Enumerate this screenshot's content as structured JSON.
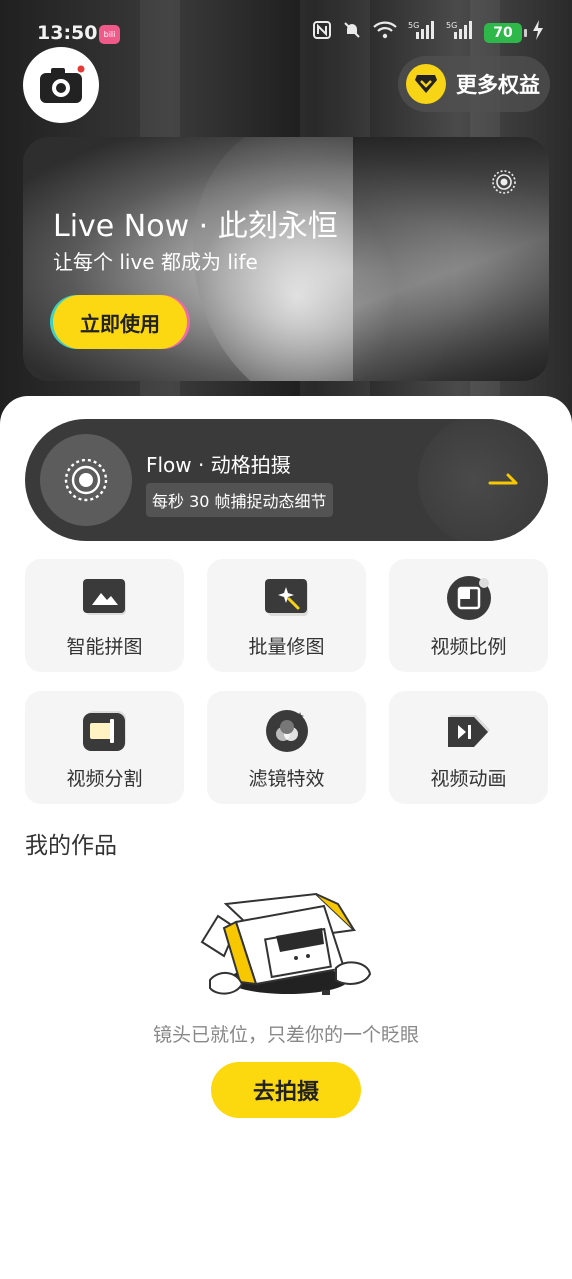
{
  "status_bar": {
    "time": "13:50",
    "app_icon": "bilibili",
    "icons": [
      "nfc-icon",
      "mute-icon",
      "wifi-icon",
      "signal-5g-icon",
      "signal-5g-icon"
    ],
    "signal_label": "5G",
    "battery": "70"
  },
  "header": {
    "camera_icon": "camera-icon",
    "benefits_label": "更多权益"
  },
  "banner": {
    "title": "Live Now · 此刻永恒",
    "subtitle": "让每个 live 都成为 life",
    "button_label": "立即使用"
  },
  "flow": {
    "title": "Flow · 动格拍摄",
    "tag": "每秒 30 帧捕捉动态细节"
  },
  "tools": [
    {
      "label": "智能拼图",
      "icon": "collage-icon"
    },
    {
      "label": "批量修图",
      "icon": "batch-edit-icon"
    },
    {
      "label": "视频比例",
      "icon": "video-ratio-icon"
    },
    {
      "label": "视频分割",
      "icon": "video-split-icon"
    },
    {
      "label": "滤镜特效",
      "icon": "filter-effects-icon"
    },
    {
      "label": "视频动画",
      "icon": "video-animation-icon"
    }
  ],
  "works": {
    "title": "我的作品",
    "empty_text": "镜头已就位，只差你的一个眨眼",
    "button_label": "去拍摄"
  },
  "colors": {
    "accent": "#fcd80f",
    "flow_card": "#3a3a3a",
    "tool_bg": "#f5f5f5",
    "battery": "#2fb84a"
  }
}
